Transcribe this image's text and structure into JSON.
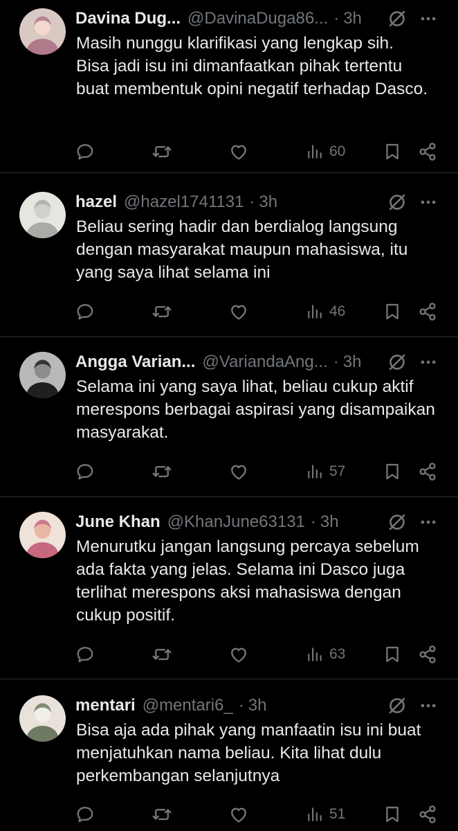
{
  "tweets": [
    {
      "name": "Davina Dug...",
      "handle": "@DavinaDuga86...",
      "sep": "·",
      "time": "3h",
      "text": "Masih nunggu klarifikasi yang lengkap sih. Bisa jadi isu ini dimanfaatkan pihak tertentu buat membentuk opini negatif terhadap Dasco.",
      "views": "60",
      "avatar_colors": [
        "#d9c9c3",
        "#b07a8a",
        "#f3d8d0"
      ]
    },
    {
      "name": "hazel",
      "handle": "@hazel1741131",
      "sep": "·",
      "time": "3h",
      "text": "Beliau sering hadir dan berdialog langsung dengan masyarakat maupun mahasiswa, itu yang saya lihat selama ini",
      "views": "46",
      "avatar_colors": [
        "#e4e6e0",
        "#a9aca6",
        "#cfd2cb"
      ]
    },
    {
      "name": "Angga Varian...",
      "handle": "@VariandaAng...",
      "sep": "·",
      "time": "3h",
      "text": "Selama ini yang saya lihat, beliau cukup aktif merespons berbagai aspirasi yang disampaikan masyarakat.",
      "views": "57",
      "avatar_colors": [
        "#b9b9b9",
        "#1f1f1f",
        "#8c8c8c"
      ]
    },
    {
      "name": "June Khan",
      "handle": "@KhanJune63131",
      "sep": "·",
      "time": "3h",
      "text": "Menurutku jangan langsung percaya sebelum ada fakta yang jelas. Selama ini Dasco juga terlihat merespons aksi mahasiswa dengan cukup positif.",
      "views": "63",
      "avatar_colors": [
        "#efe2d8",
        "#c8687f",
        "#e9b7a4"
      ]
    },
    {
      "name": "mentari",
      "handle": "@mentari6_",
      "sep": "·",
      "time": "3h",
      "text": "Bisa aja ada pihak yang manfaatin isu ini buat menjatuhkan nama beliau. Kita lihat dulu perkembangan selanjutnya",
      "views": "51",
      "avatar_colors": [
        "#e8e2da",
        "#6f7a63",
        "#f2efe9"
      ]
    }
  ],
  "icons": {
    "reply": "reply-icon",
    "retweet": "retweet-icon",
    "like": "like-icon",
    "views": "views-icon",
    "bookmark": "bookmark-icon",
    "share": "share-icon",
    "mute": "mute-icon",
    "more": "more-icon"
  },
  "colors": {
    "background": "#000000",
    "text": "#e7e9ea",
    "secondary": "#71767b",
    "divider": "#2f3336"
  }
}
